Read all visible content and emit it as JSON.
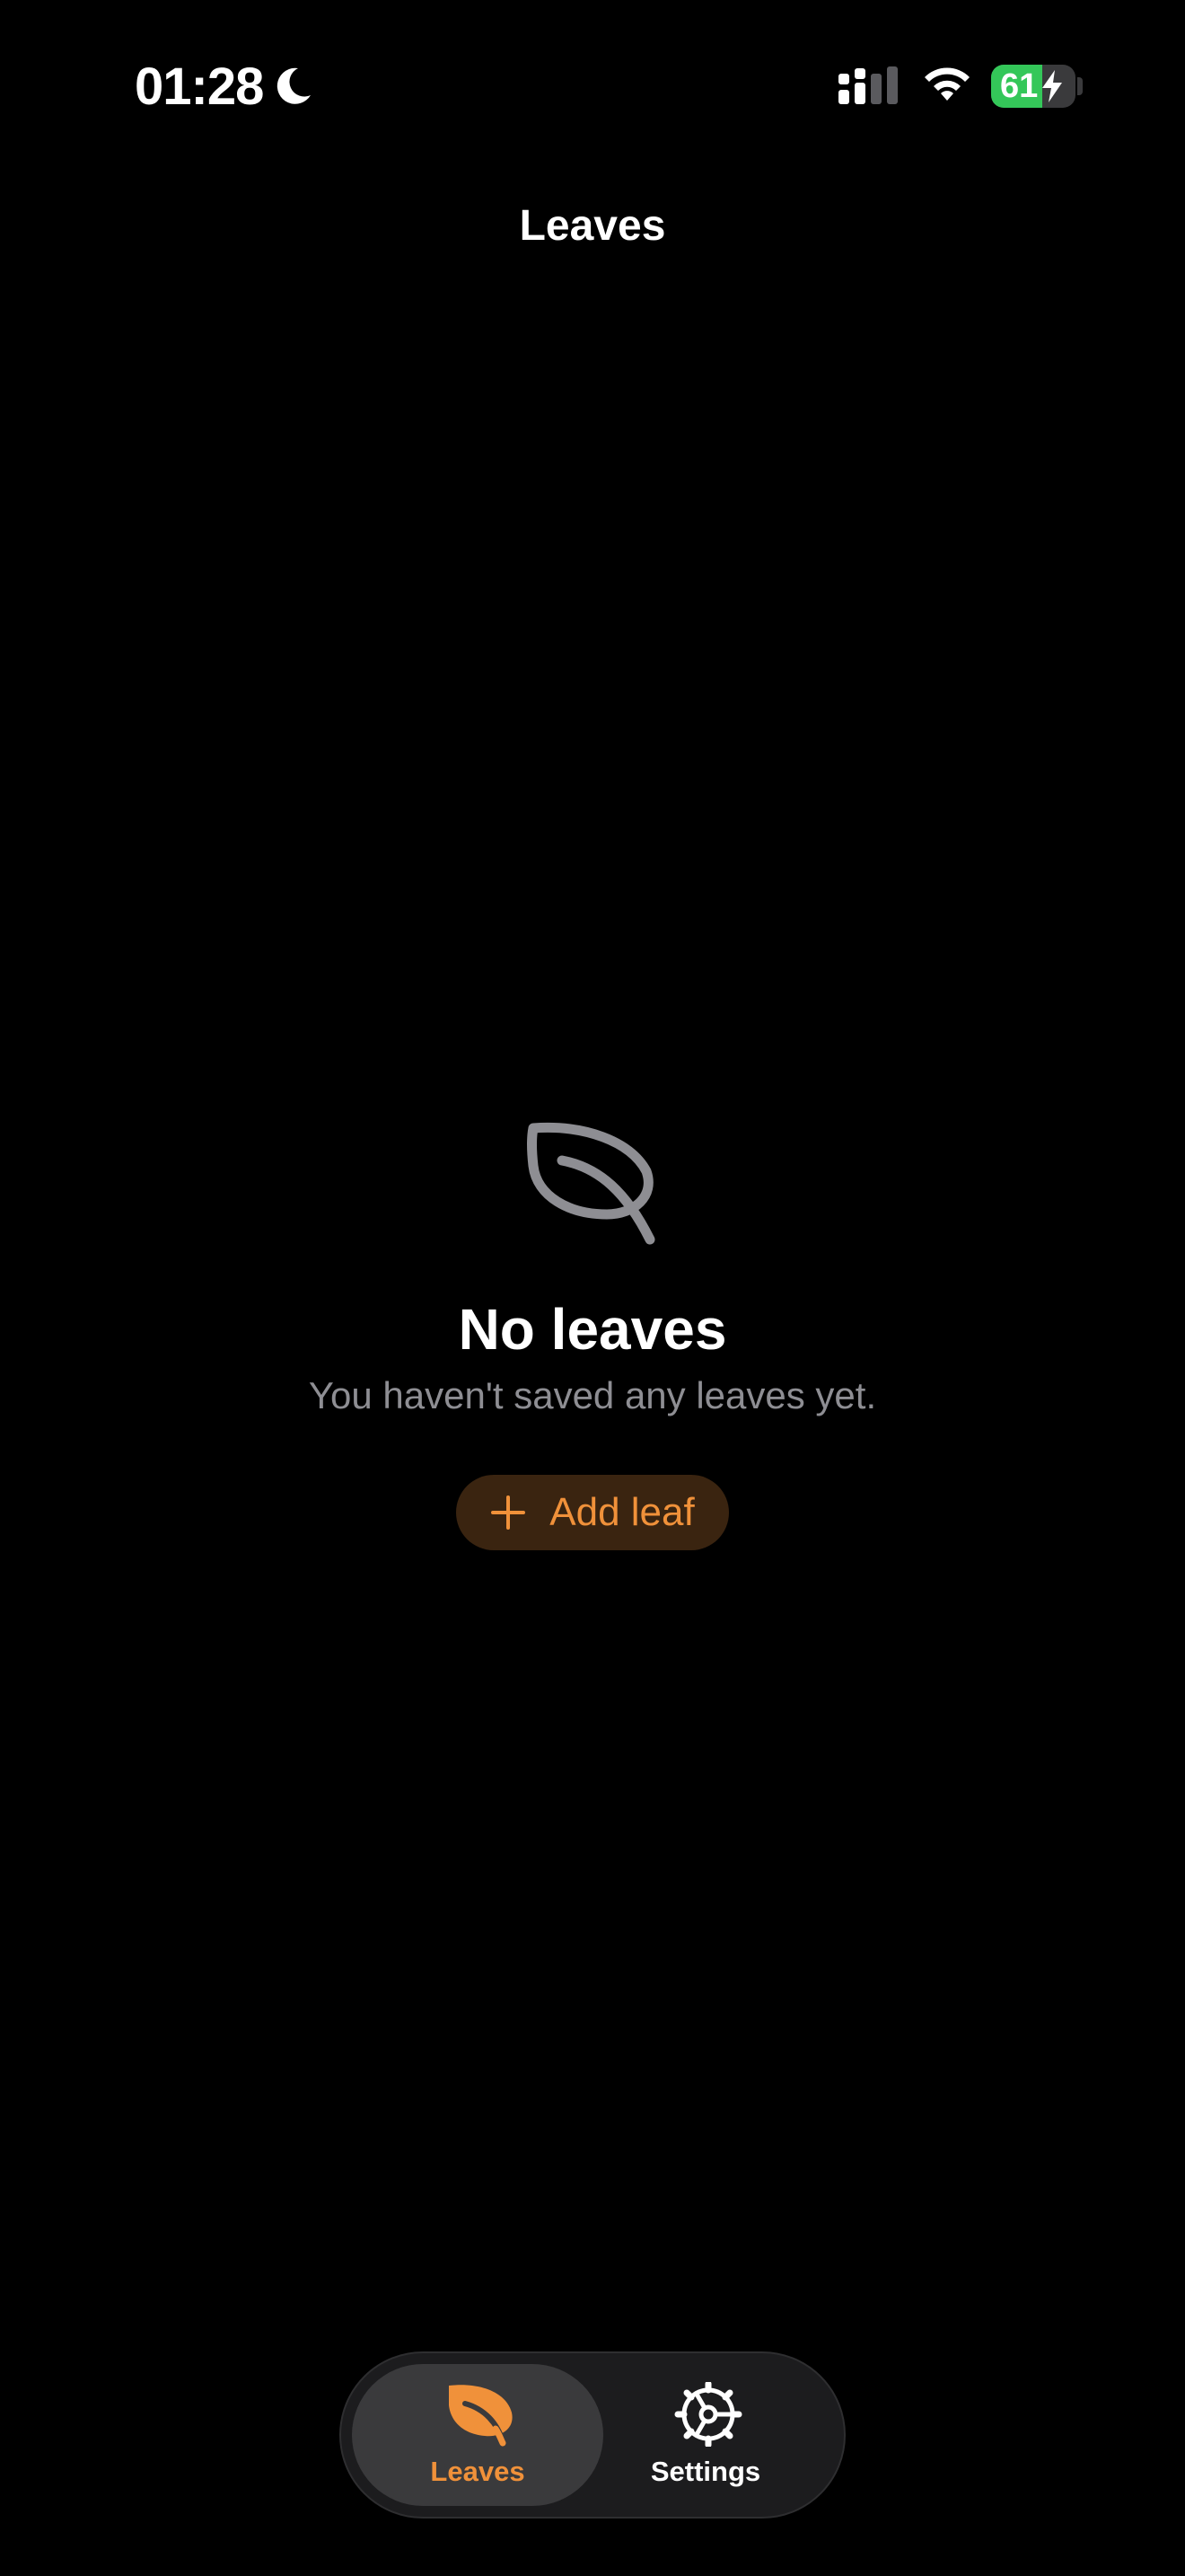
{
  "status_bar": {
    "time": "01:28",
    "battery_level": "61",
    "battery_fraction": 0.61,
    "icons": [
      "moon-icon",
      "cellular-signal-icon",
      "wifi-icon",
      "battery-icon",
      "charging-bolt-icon"
    ]
  },
  "navigation": {
    "title": "Leaves"
  },
  "empty_state": {
    "icon": "leaf-outline-icon",
    "title": "No leaves",
    "subtitle": "You haven't saved any leaves yet.",
    "button_label": "Add leaf",
    "button_icon": "plus-icon"
  },
  "tab_bar": {
    "tabs": [
      {
        "label": "Leaves",
        "icon": "leaf-icon",
        "selected": true
      },
      {
        "label": "Settings",
        "icon": "gear-icon",
        "selected": false
      }
    ]
  },
  "colors": {
    "background": "#000000",
    "accent": "#f0913a",
    "accent_bg": "#3a2410",
    "secondary_text": "#8e8e93",
    "battery_green": "#34c759",
    "tab_bar_bg": "#1c1c1e",
    "tab_selected_bg": "#3a3a3c"
  }
}
